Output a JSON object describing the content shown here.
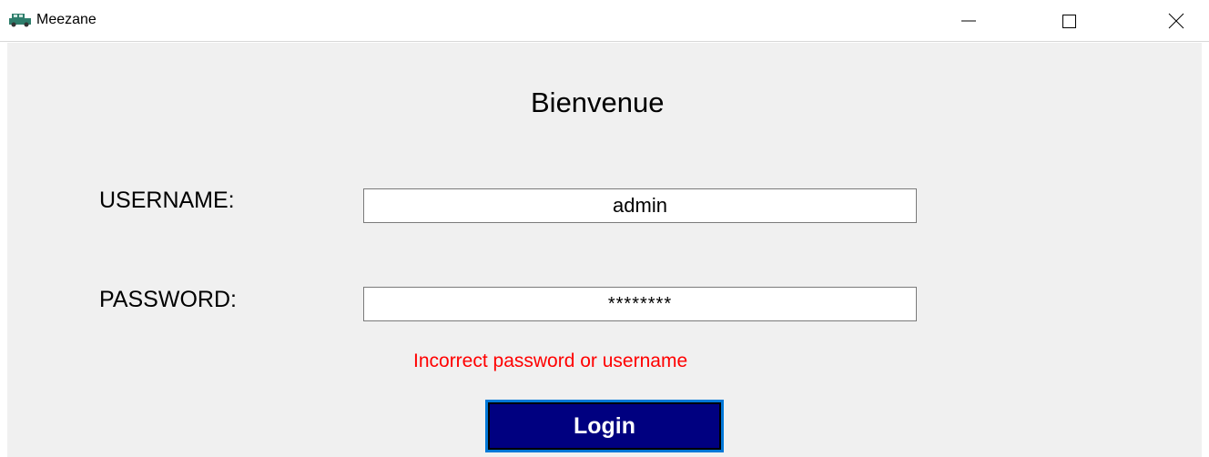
{
  "window": {
    "title": "Meezane",
    "app_icon": "car-icon",
    "controls": {
      "minimize_icon": "minimize-icon",
      "maximize_icon": "maximize-icon",
      "close_icon": "close-icon"
    }
  },
  "login_form": {
    "heading": "Bienvenue",
    "username_label": "USERNAME:",
    "username_value": "admin",
    "password_label": "PASSWORD:",
    "password_value": "********",
    "error_message": "Incorrect password or username",
    "login_button_label": "Login"
  },
  "colors": {
    "client_background": "#f0f0f0",
    "error": "#ff0000",
    "login_button_background": "#000080",
    "login_button_focus_border": "#0078d7",
    "app_icon": "#2e7d6b"
  }
}
